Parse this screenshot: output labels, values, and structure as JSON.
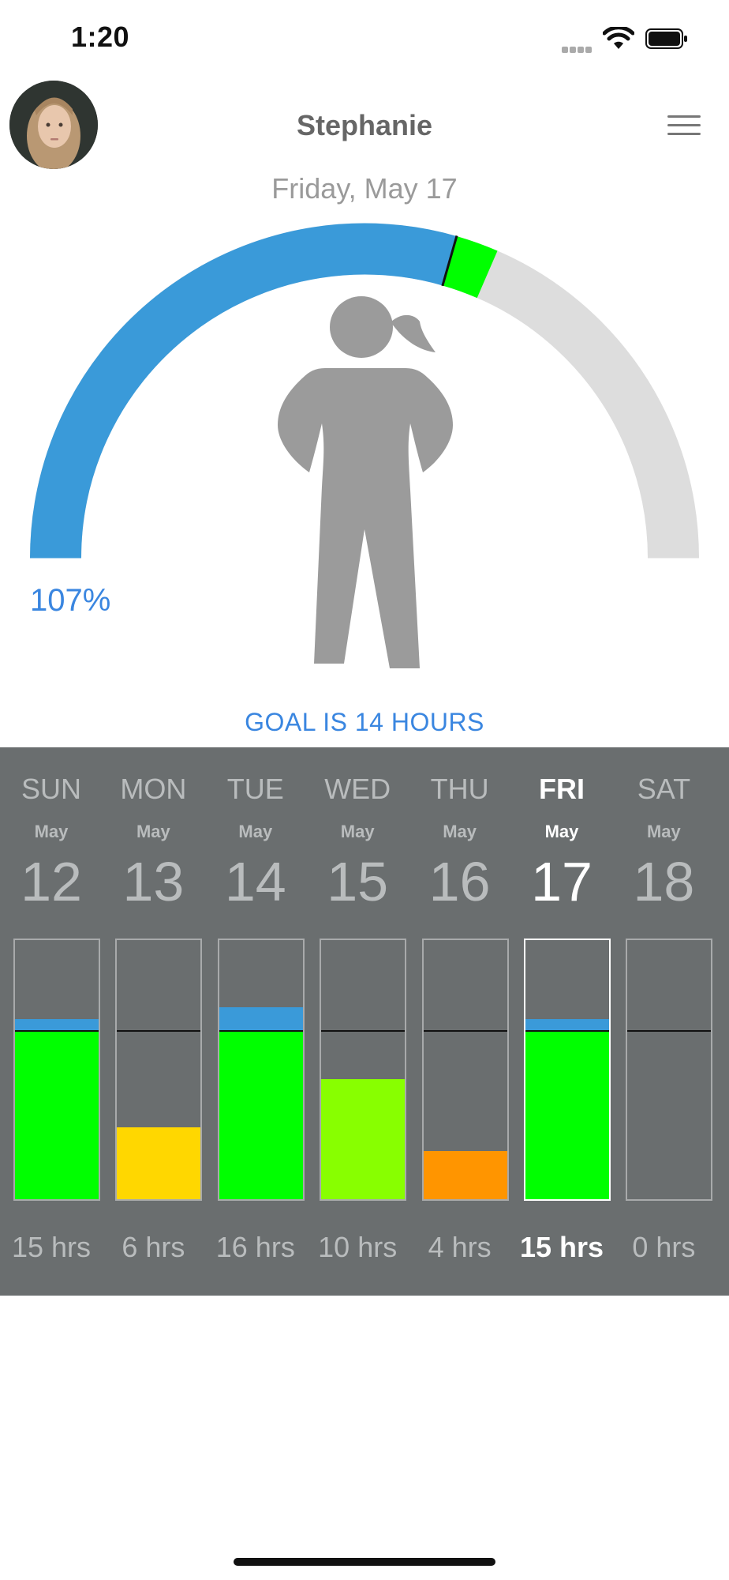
{
  "status_bar": {
    "time": "1:20",
    "icons": [
      "cellular-signal-icon",
      "wifi-icon",
      "battery-icon"
    ]
  },
  "header": {
    "user_name": "Stephanie",
    "avatar": "profile-photo",
    "menu_icon": "hamburger-menu-icon"
  },
  "date_label": "Friday, May 17",
  "gauge": {
    "percent_label": "107%",
    "progress_fraction": 1.07,
    "colors": {
      "progress": "#3a9ad9",
      "excess": "#00ff00",
      "track": "#dddddd",
      "figure": "#9b9b9b"
    },
    "figure_icon": "girl-figure-icon"
  },
  "goal_text": "GOAL IS 14 HOURS",
  "goal_hours": 14,
  "week": {
    "days": [
      {
        "dow": "SUN",
        "month": "May",
        "day": "12",
        "hours_label": "15 hrs",
        "hours": 15,
        "color": "#00ff00",
        "selected": false
      },
      {
        "dow": "MON",
        "month": "May",
        "day": "13",
        "hours_label": "6 hrs",
        "hours": 6,
        "color": "#ffd700",
        "selected": false
      },
      {
        "dow": "TUE",
        "month": "May",
        "day": "14",
        "hours_label": "16 hrs",
        "hours": 16,
        "color": "#00ff00",
        "selected": false
      },
      {
        "dow": "WED",
        "month": "May",
        "day": "15",
        "hours_label": "10 hrs",
        "hours": 10,
        "color": "#88ff00",
        "selected": false
      },
      {
        "dow": "THU",
        "month": "May",
        "day": "16",
        "hours_label": "4 hrs",
        "hours": 4,
        "color": "#ff9500",
        "selected": false
      },
      {
        "dow": "FRI",
        "month": "May",
        "day": "17",
        "hours_label": "15 hrs",
        "hours": 15,
        "color": "#00ff00",
        "selected": true
      },
      {
        "dow": "SAT",
        "month": "May",
        "day": "18",
        "hours_label": "0 hrs",
        "hours": 0,
        "color": "#00ff00",
        "selected": false
      }
    ],
    "excess_color": "#3a9ad9",
    "panel_color": "#6a6e6f"
  }
}
